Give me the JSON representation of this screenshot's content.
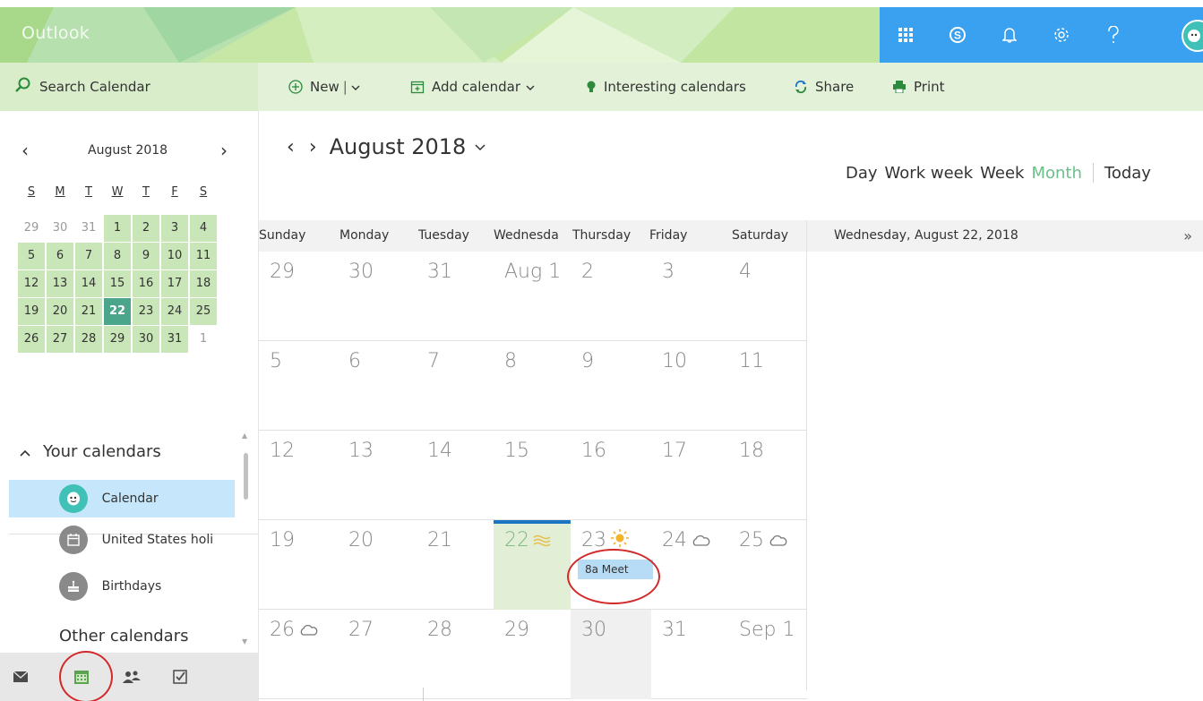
{
  "header": {
    "app_name": "Outlook",
    "icons": [
      "app-launcher-icon",
      "skype-icon",
      "bell-icon",
      "gear-icon",
      "help-icon"
    ]
  },
  "commandbar": {
    "search_placeholder": "Search Calendar",
    "new_label": "New",
    "add_calendar_label": "Add calendar",
    "interesting_label": "Interesting calendars",
    "share_label": "Share",
    "print_label": "Print"
  },
  "minical": {
    "title": "August 2018",
    "dow": [
      "S",
      "M",
      "T",
      "W",
      "T",
      "F",
      "S"
    ],
    "weeks": [
      [
        {
          "d": "29",
          "s": "out"
        },
        {
          "d": "30",
          "s": "out"
        },
        {
          "d": "31",
          "s": "out"
        },
        {
          "d": "1",
          "s": "in"
        },
        {
          "d": "2",
          "s": "in"
        },
        {
          "d": "3",
          "s": "in"
        },
        {
          "d": "4",
          "s": "in"
        }
      ],
      [
        {
          "d": "5",
          "s": "in"
        },
        {
          "d": "6",
          "s": "in"
        },
        {
          "d": "7",
          "s": "in"
        },
        {
          "d": "8",
          "s": "in"
        },
        {
          "d": "9",
          "s": "in"
        },
        {
          "d": "10",
          "s": "in"
        },
        {
          "d": "11",
          "s": "in"
        }
      ],
      [
        {
          "d": "12",
          "s": "in"
        },
        {
          "d": "13",
          "s": "in"
        },
        {
          "d": "14",
          "s": "in"
        },
        {
          "d": "15",
          "s": "in"
        },
        {
          "d": "16",
          "s": "in"
        },
        {
          "d": "17",
          "s": "in"
        },
        {
          "d": "18",
          "s": "in"
        }
      ],
      [
        {
          "d": "19",
          "s": "in"
        },
        {
          "d": "20",
          "s": "in"
        },
        {
          "d": "21",
          "s": "in"
        },
        {
          "d": "22",
          "s": "today"
        },
        {
          "d": "23",
          "s": "in"
        },
        {
          "d": "24",
          "s": "in"
        },
        {
          "d": "25",
          "s": "in"
        }
      ],
      [
        {
          "d": "26",
          "s": "in"
        },
        {
          "d": "27",
          "s": "in"
        },
        {
          "d": "28",
          "s": "in"
        },
        {
          "d": "29",
          "s": "in"
        },
        {
          "d": "30",
          "s": "in"
        },
        {
          "d": "31",
          "s": "in"
        },
        {
          "d": "1",
          "s": "out"
        }
      ]
    ]
  },
  "calendars": {
    "your_header": "Your calendars",
    "items": [
      {
        "label": "Calendar",
        "icon": "calendar-avatar-icon",
        "color": "#3fc1b7",
        "selected": true
      },
      {
        "label": "United States holi",
        "icon": "holiday-calendar-icon",
        "color": "#8a8a8a",
        "selected": false
      },
      {
        "label": "Birthdays",
        "icon": "birthday-cake-icon",
        "color": "#8a8a8a",
        "selected": false
      }
    ],
    "other_header": "Other calendars"
  },
  "switcher": [
    "mail-icon",
    "calendar-icon",
    "people-icon",
    "tasks-icon"
  ],
  "main": {
    "month_title": "August 2018",
    "views": [
      "Day",
      "Work week",
      "Week",
      "Month"
    ],
    "active_view": "Month",
    "today_label": "Today",
    "day_names": [
      "Sunday",
      "Monday",
      "Tuesday",
      "Wednesda",
      "Thursday",
      "Friday",
      "Saturday"
    ],
    "weeks": [
      [
        {
          "n": "29"
        },
        {
          "n": "30"
        },
        {
          "n": "31"
        },
        {
          "n": "Aug 1"
        },
        {
          "n": "2"
        },
        {
          "n": "3"
        },
        {
          "n": "4"
        }
      ],
      [
        {
          "n": "5"
        },
        {
          "n": "6"
        },
        {
          "n": "7"
        },
        {
          "n": "8"
        },
        {
          "n": "9"
        },
        {
          "n": "10"
        },
        {
          "n": "11"
        }
      ],
      [
        {
          "n": "12"
        },
        {
          "n": "13"
        },
        {
          "n": "14"
        },
        {
          "n": "15"
        },
        {
          "n": "16"
        },
        {
          "n": "17"
        },
        {
          "n": "18"
        }
      ],
      [
        {
          "n": "19"
        },
        {
          "n": "20"
        },
        {
          "n": "21"
        },
        {
          "n": "22",
          "today": true,
          "weather": "haze-icon"
        },
        {
          "n": "23",
          "weather": "sun-icon",
          "event": "8a Meet"
        },
        {
          "n": "24",
          "weather": "cloud-icon"
        },
        {
          "n": "25",
          "weather": "cloud-icon"
        }
      ],
      [
        {
          "n": "26",
          "weather": "cloud-icon"
        },
        {
          "n": "27"
        },
        {
          "n": "28"
        },
        {
          "n": "29"
        },
        {
          "n": "30",
          "gray": true
        },
        {
          "n": "31"
        },
        {
          "n": "Sep 1"
        }
      ]
    ]
  },
  "side_panel": {
    "date": "Wednesday, August 22, 2018",
    "collapse_glyph": "»"
  },
  "colors": {
    "accent_blue": "#3aa0f0",
    "today_green": "#4aa58a",
    "month_in_bg": "#c9e6b8",
    "event_bg": "#b7dcf5",
    "annotation_red": "#d22a2a"
  }
}
